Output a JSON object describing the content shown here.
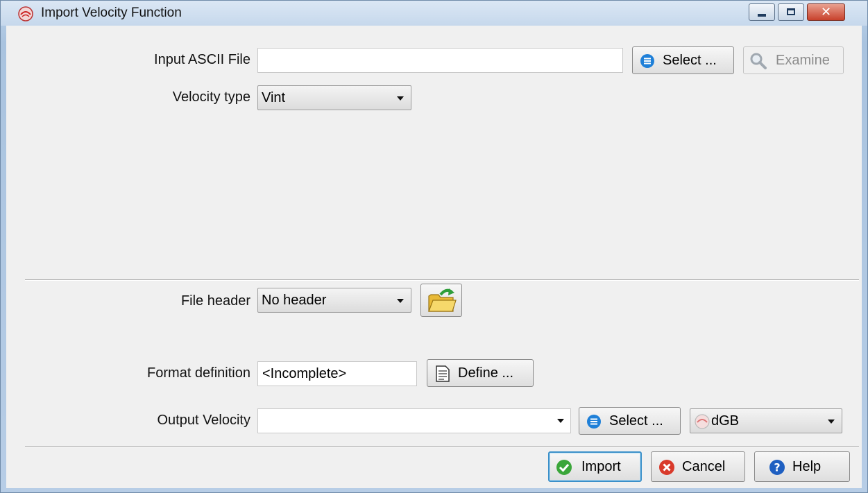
{
  "window": {
    "title": "Import Velocity Function"
  },
  "input_file": {
    "label": "Input ASCII File",
    "value": "",
    "select_label": "Select ...",
    "examine_label": "Examine"
  },
  "velocity_type": {
    "label": "Velocity type",
    "selected": "Vint"
  },
  "file_header": {
    "label": "File header",
    "selected": "No header"
  },
  "format_definition": {
    "label": "Format definition",
    "value": "<Incomplete>",
    "define_label": "Define ..."
  },
  "output_velocity": {
    "label": "Output Velocity",
    "value": "",
    "select_label": "Select ...",
    "storage_selected": "dGB"
  },
  "footer": {
    "import_label": "Import",
    "cancel_label": "Cancel",
    "help_label": "Help"
  },
  "colors": {
    "accent_blue": "#1f80d8",
    "import_green": "#3aa63a",
    "cancel_red": "#d93a2b",
    "help_blue": "#1e5fc1"
  },
  "icons": {
    "app": "opendtect-logo-icon",
    "select": "list-circle-icon",
    "examine": "magnifier-icon",
    "folder": "open-folder-icon",
    "define": "document-edit-icon",
    "import": "checkmark-circle-icon",
    "cancel": "x-circle-icon",
    "help": "question-circle-icon"
  }
}
